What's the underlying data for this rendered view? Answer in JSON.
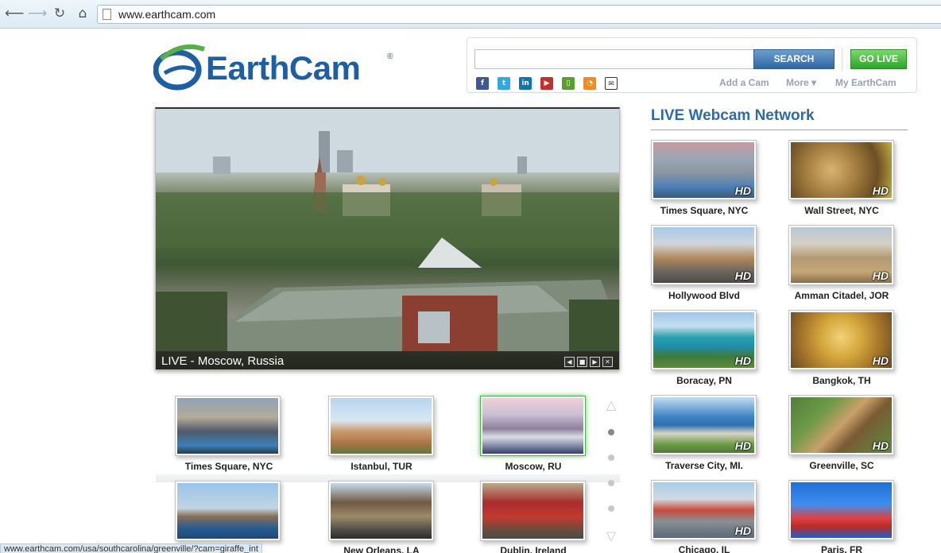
{
  "browser": {
    "url": "www.earthcam.com"
  },
  "header": {
    "logo_text": "EarthCam",
    "logo_reg": "®",
    "search": {
      "value": "",
      "placeholder": "",
      "button_label": "SEARCH"
    },
    "go_live_label": "GO LIVE",
    "social_icons": [
      "facebook-icon",
      "twitter-icon",
      "linkedin-icon",
      "youtube-icon",
      "mobile-icon",
      "rss-icon",
      "email-icon"
    ],
    "links": {
      "add_cam": "Add a Cam",
      "more": "More ▾",
      "my_earthcam": "My EarthCam"
    }
  },
  "player": {
    "caption": "LIVE - Moscow, Russia"
  },
  "bottom_thumbs": [
    {
      "label": "Times Square, NYC"
    },
    {
      "label": "Istanbul, TUR"
    },
    {
      "label": "Moscow, RU",
      "active": true
    },
    {
      "label": ""
    },
    {
      "label": "New Orleans, LA"
    },
    {
      "label": "Dublin, Ireland"
    }
  ],
  "network": {
    "title": "LIVE Webcam Network",
    "hd_label": "HD",
    "cams": [
      {
        "label": "Times Square, NYC",
        "hd": true
      },
      {
        "label": "Wall Street, NYC",
        "hd": true
      },
      {
        "label": "Hollywood Blvd",
        "hd": true
      },
      {
        "label": "Amman Citadel, JOR",
        "hd": true
      },
      {
        "label": "Boracay, PN",
        "hd": true
      },
      {
        "label": "Bangkok, TH",
        "hd": true
      },
      {
        "label": "Traverse City, MI.",
        "hd": true
      },
      {
        "label": "Greenville, SC",
        "hd": true
      },
      {
        "label": "Chicago, IL",
        "hd": true
      },
      {
        "label": "Paris, FR",
        "hd": false
      }
    ]
  },
  "status_bar": {
    "text": "www.earthcam.com/usa/southcarolina/greenville/?cam=giraffe_int"
  }
}
